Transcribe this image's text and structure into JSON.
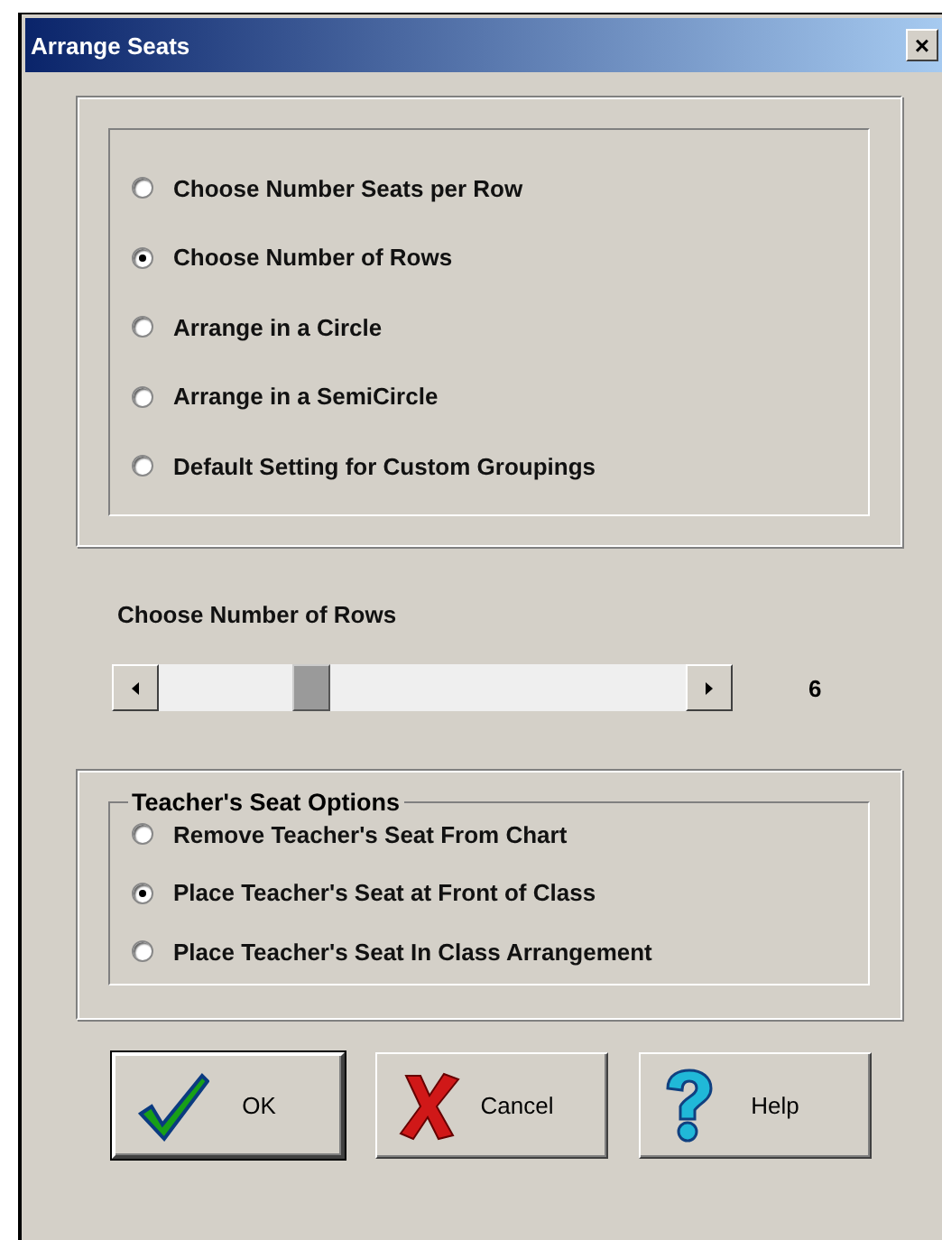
{
  "window": {
    "title": "Arrange Seats",
    "close": "×"
  },
  "arrangement_options": [
    {
      "label": "Choose Number Seats per Row",
      "selected": false
    },
    {
      "label": "Choose Number of Rows",
      "selected": true
    },
    {
      "label": "Arrange in a Circle",
      "selected": false
    },
    {
      "label": "Arrange in a SemiCircle",
      "selected": false
    },
    {
      "label": "Default Setting for Custom Groupings",
      "selected": false
    }
  ],
  "slider": {
    "label": "Choose Number of Rows",
    "reading": "6"
  },
  "teacher_seat": {
    "legend": "Teacher's Seat Options",
    "options": [
      {
        "label": "Remove Teacher's Seat From Chart",
        "selected": false
      },
      {
        "label": "Place Teacher's Seat at Front of Class",
        "selected": true
      },
      {
        "label": "Place Teacher's Seat In Class Arrangement",
        "selected": false
      }
    ]
  },
  "buttons": [
    {
      "kind": "ok",
      "label": "OK",
      "default": true
    },
    {
      "kind": "cancel",
      "label": "Cancel",
      "default": false
    },
    {
      "kind": "help",
      "label": "Help",
      "default": false
    }
  ]
}
